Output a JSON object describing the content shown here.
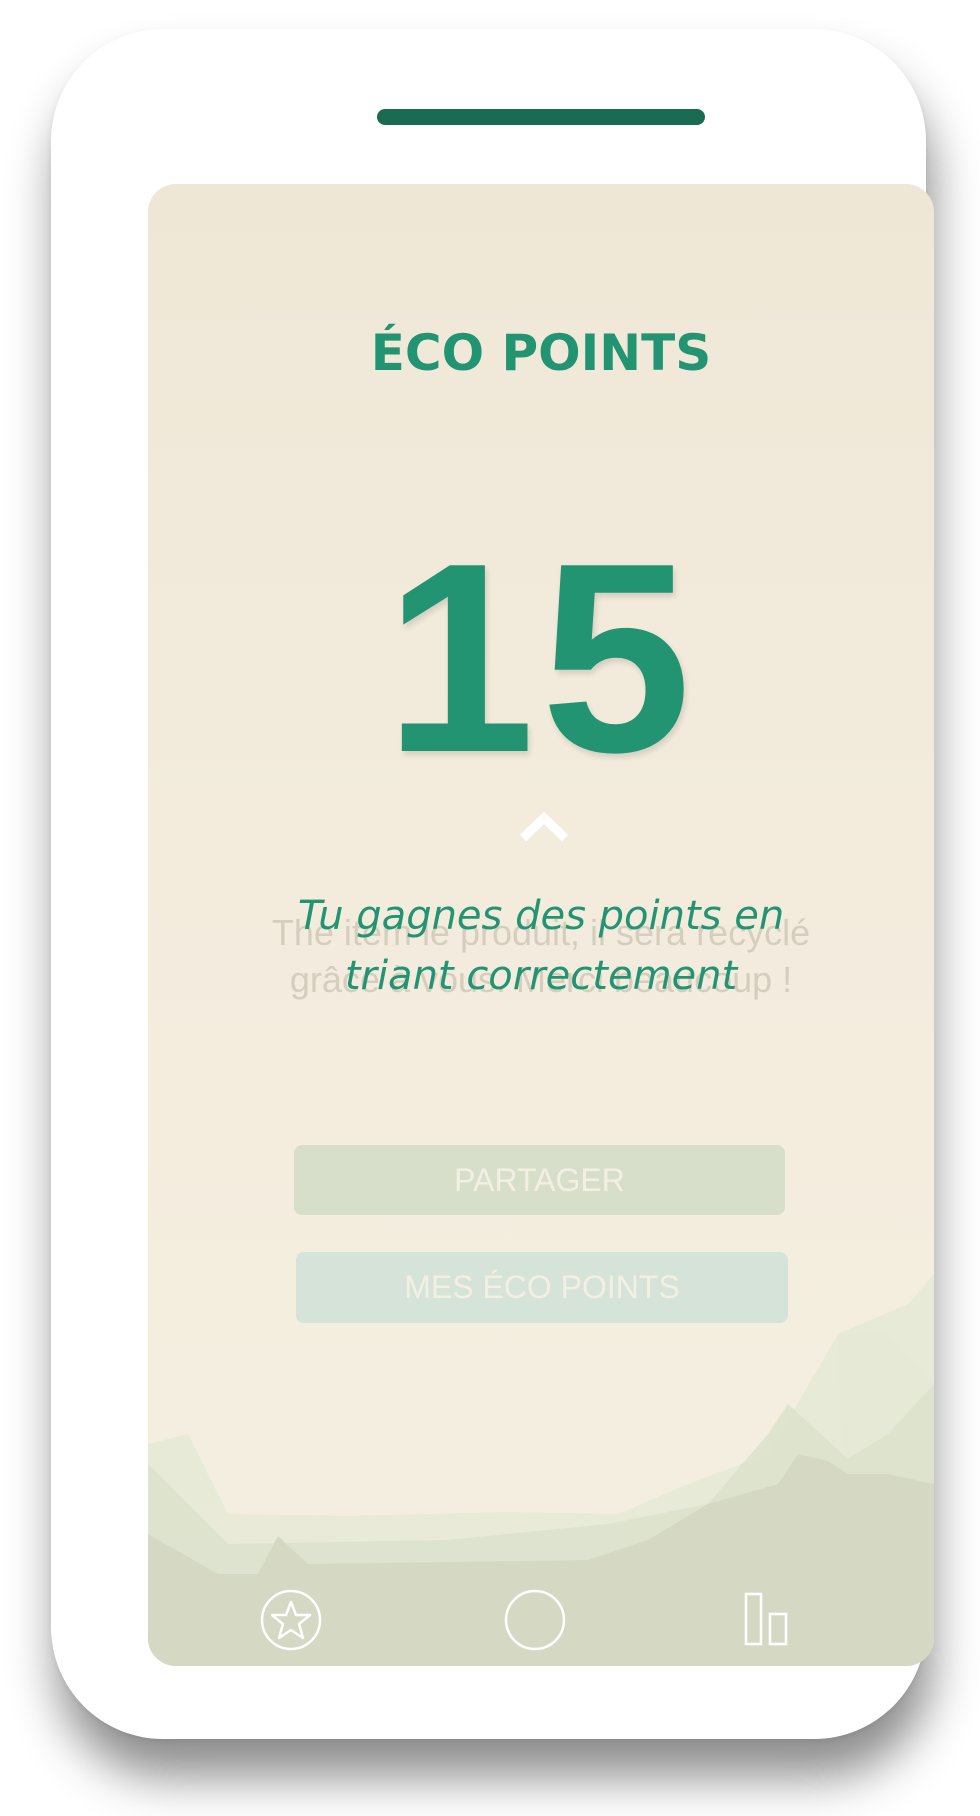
{
  "screen": {
    "title": "ÉCO POINTS",
    "points_value": "15",
    "tagline": "Tu gagnes des points en triant correctement",
    "ghost_text": "The item le produit, il sera recyclé grâce à vous. Merci beaucoup !",
    "buttons": {
      "share_label": "PARTAGER",
      "my_points_label": "MES ÉCO POINTS"
    }
  },
  "nav": {
    "items": [
      {
        "icon": "star-icon"
      },
      {
        "icon": "circle-icon"
      },
      {
        "icon": "bar-chart-icon"
      }
    ]
  },
  "colors": {
    "accent": "#229472",
    "speaker": "#1a6b52",
    "background": "#f3ecdd",
    "hills": "#d5d9c4"
  }
}
